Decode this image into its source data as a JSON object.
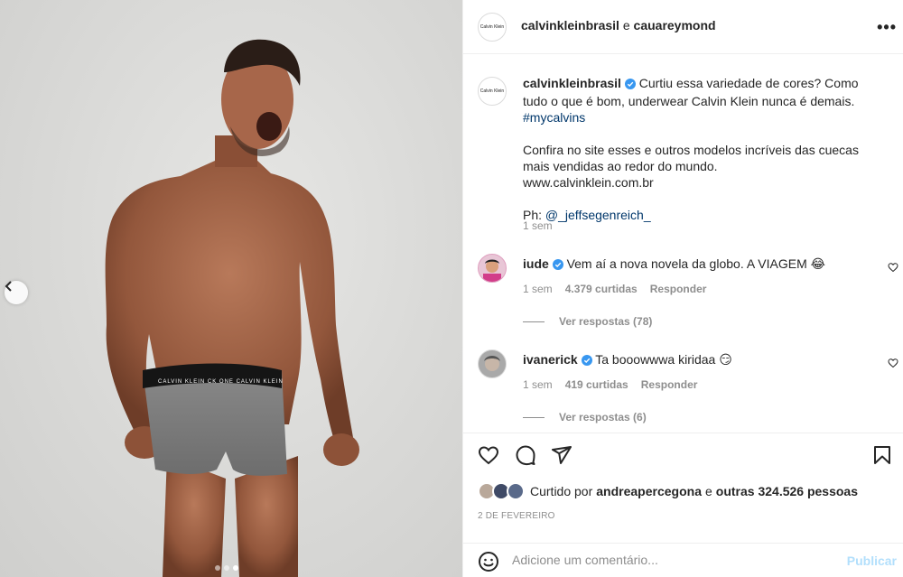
{
  "header": {
    "account": "calvinkleinbrasil",
    "conjunction": "e",
    "coauthor": "cauareymond",
    "avatar_text": "Calvin Klein",
    "more_icon": "more-options-icon"
  },
  "caption": {
    "username": "calvinkleinbrasil",
    "line1": "Curtiu essa variedade de cores? Como tudo o que é bom, underwear Calvin Klein nunca é demais.",
    "hashtag": "#mycalvins",
    "line2": "Confira no site esses e outros modelos incríveis das cuecas mais vendidas ao redor do mundo.",
    "website": "www.calvinklein.com.br",
    "credit_prefix": "Ph:",
    "credit_handle": "@_jeffsegenreich_",
    "time": "1 sem"
  },
  "comments": [
    {
      "user": "iude",
      "text": "Vem aí a nova novela da globo. A VIAGEM 😂",
      "time": "1 sem",
      "likes": "4.379 curtidas",
      "reply": "Responder",
      "view_replies": "Ver respostas (78)"
    },
    {
      "user": "ivanerick",
      "text": "Ta booowwwa kiridaa 😏",
      "time": "1 sem",
      "likes": "419 curtidas",
      "reply": "Responder",
      "view_replies": "Ver respostas (6)"
    }
  ],
  "likes": {
    "prefix": "Curtido por",
    "first_user": "andreapercegona",
    "conj": "e",
    "others": "outras 324.526 pessoas"
  },
  "date": "2 DE FEVEREIRO",
  "add_comment": {
    "placeholder": "Adicione um comentário...",
    "publish": "Publicar"
  },
  "colors": {
    "verified": "#3897f0",
    "link": "#00376b",
    "muted": "#8e8e8e",
    "publish_disabled": "#b2dffc"
  },
  "carousel": {
    "slides": 3,
    "active_index": 2
  }
}
